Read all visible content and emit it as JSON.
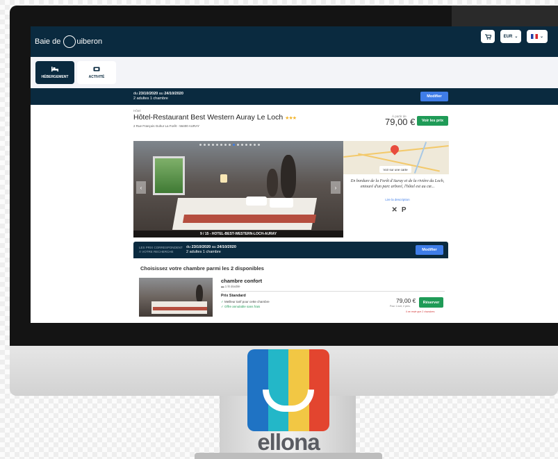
{
  "header": {
    "logo_prefix": "Baie de",
    "logo_suffix": "uiberon",
    "logo_letter": "Q",
    "cart_icon": "cart-icon",
    "currency": "EUR",
    "language_flag": "french-flag-icon"
  },
  "tabs": [
    {
      "label": "HÉBERGEMENT",
      "icon": "bed-icon"
    },
    {
      "label": "ACTIVITÉ",
      "icon": "ticket-icon"
    }
  ],
  "search": {
    "dates_prefix": "du ",
    "date_from": "23/10/2020",
    "dates_mid": " au ",
    "date_to": "24/10/2020",
    "guests": "2 adultes 1 chambre",
    "modify_label": "Modifier"
  },
  "hotel": {
    "type": "Hôtel",
    "name": "Hôtel-Restaurant Best Western Auray Le Loch",
    "stars": "★★★",
    "address": "2 Rue François Guhur La Forêt - 56400 AURAY",
    "from_label": "À partir de",
    "price": "79,00 €",
    "see_prices_label": "Voir les prix"
  },
  "gallery": {
    "caption": "9 / 15 - HOTEL-BEST-WESTERN-LOCH-AURAY",
    "dots": 15,
    "active_dot": 9,
    "prev_icon": "chevron-left-icon",
    "next_icon": "chevron-right-icon"
  },
  "map": {
    "button_label": "Voir sur une carte"
  },
  "description": {
    "text": "En bordure de la Forêt d'Auray et de la rivière du Loch, entouré d'un parc arboré, l'hôtel est au cœ...",
    "link": "Lire la description",
    "amenities": [
      "✕",
      "P"
    ]
  },
  "rooms_search": {
    "left_label_1": "LES PRIX CORRESPONDENT",
    "left_label_2": "À VOTRE RECHERCHE",
    "dates_prefix": "du ",
    "date_from": "23/10/2020",
    "dates_mid": " au ",
    "date_to": "24/10/2020",
    "guests": "2 adultes 1 chambre",
    "modify_label": "Modifier"
  },
  "rooms": {
    "heading": "Choisissez votre chambre parmi les 2 disponibles",
    "items": [
      {
        "name": "chambre confort",
        "bed": "1 lit double",
        "rate_title": "Prix Standard",
        "features": [
          "Meilleur tarif pour cette chambre",
          "Offre annulable sans frais"
        ],
        "price": "79,00 €",
        "price_sub": "Pour 1 nuit, 2 pers.",
        "book_label": "Réserver",
        "warning": "Il ne reste que 2 chambres"
      }
    ]
  },
  "brand": {
    "name": "ellona",
    "colors": [
      "#1f73c4",
      "#23b7c8",
      "#f2c744",
      "#e3452f"
    ]
  }
}
